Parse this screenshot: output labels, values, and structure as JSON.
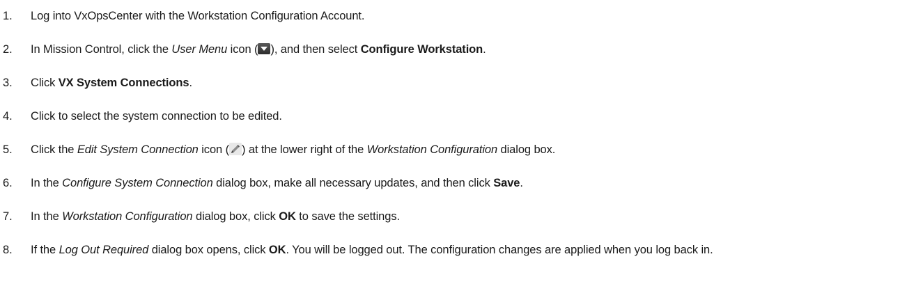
{
  "steps": [
    {
      "num": "1.",
      "text": "Log into VxOpsCenter with the Workstation Configuration Account."
    },
    {
      "num": "2.",
      "t1": "In Mission Control, click the ",
      "i1": "User Menu",
      "t2": " icon (",
      "icon": "user-menu-dropdown-icon",
      "t3": "), and then select ",
      "b1": "Configure Workstation",
      "t4": "."
    },
    {
      "num": "3.",
      "t1": "Click ",
      "b1": "VX System Connections",
      "t2": "."
    },
    {
      "num": "4.",
      "text": "Click to select the system connection to be edited."
    },
    {
      "num": "5.",
      "t1": "Click the ",
      "i1": "Edit System Connection",
      "t2": " icon (",
      "icon": "pencil-edit-icon",
      "t3": ") at the lower right of the ",
      "i2": "Workstation Configuration",
      "t4": " dialog box."
    },
    {
      "num": "6.",
      "t1": "In the ",
      "i1": "Configure System Connection",
      "t2": " dialog box, make all necessary updates, and then click ",
      "b1": "Save",
      "t3": "."
    },
    {
      "num": "7.",
      "t1": "In the ",
      "i1": "Workstation Configuration",
      "t2": " dialog box, click ",
      "b1": "OK",
      "t3": " to save the settings."
    },
    {
      "num": "8.",
      "t1": "If the ",
      "i1": "Log Out Required",
      "t2": " dialog box opens, click ",
      "b1": "OK",
      "t3": ". You will be logged out. The configuration changes are applied when you log back in."
    }
  ]
}
